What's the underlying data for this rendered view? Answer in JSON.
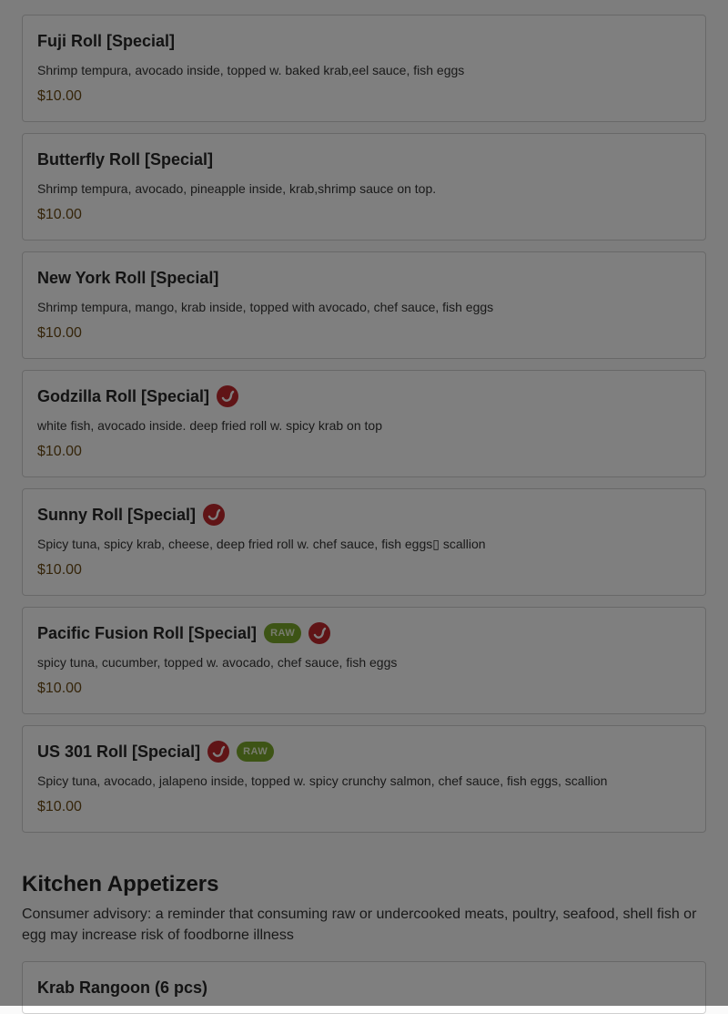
{
  "items": [
    {
      "name": "Fuji Roll [Special]",
      "desc": "Shrimp tempura, avocado inside, topped w. baked krab,eel sauce, fish eggs",
      "price": "$10.00"
    },
    {
      "name": "Butterfly Roll [Special]",
      "desc": "Shrimp tempura, avocado, pineapple inside, krab,shrimp sauce on top.",
      "price": "$10.00"
    },
    {
      "name": "New York Roll [Special]",
      "desc": "Shrimp tempura, mango, krab inside, topped with avocado, chef sauce, fish eggs",
      "price": "$10.00"
    },
    {
      "name": "Godzilla Roll [Special]",
      "desc": "white fish, avocado inside. deep fried roll w. spicy krab on top",
      "price": "$10.00",
      "badges": [
        "spicy-icon"
      ]
    },
    {
      "name": "Sunny Roll [Special]",
      "desc": "Spicy tuna, spicy krab, cheese, deep fried roll w. chef sauce, fish eggs▯ scallion",
      "price": "$10.00",
      "badges": [
        "spicy-icon"
      ]
    },
    {
      "name": "Pacific Fusion Roll [Special]",
      "desc": "spicy tuna, cucumber, topped w. avocado, chef sauce, fish eggs",
      "price": "$10.00",
      "badges": [
        "raw",
        "spicy-icon"
      ]
    },
    {
      "name": "US 301 Roll [Special]",
      "desc": "Spicy tuna, avocado, jalapeno inside, topped w. spicy crunchy salmon, chef sauce, fish eggs, scallion",
      "price": "$10.00",
      "badges": [
        "spicy-icon",
        "raw"
      ]
    }
  ],
  "badge_labels": {
    "raw": "RAW"
  },
  "section": {
    "title": "Kitchen Appetizers",
    "advisory": "Consumer advisory: a reminder that consuming raw or undercooked meats, poultry, seafood, shell fish or egg may increase risk of foodborne illness"
  },
  "next_item": {
    "name": "Krab Rangoon (6 pcs)"
  },
  "colors": {
    "raw_badge": "#7aa82a",
    "spicy": "#c0282d",
    "price": "#6b4a14",
    "overlay": "rgba(0,0,0,0.5)"
  }
}
